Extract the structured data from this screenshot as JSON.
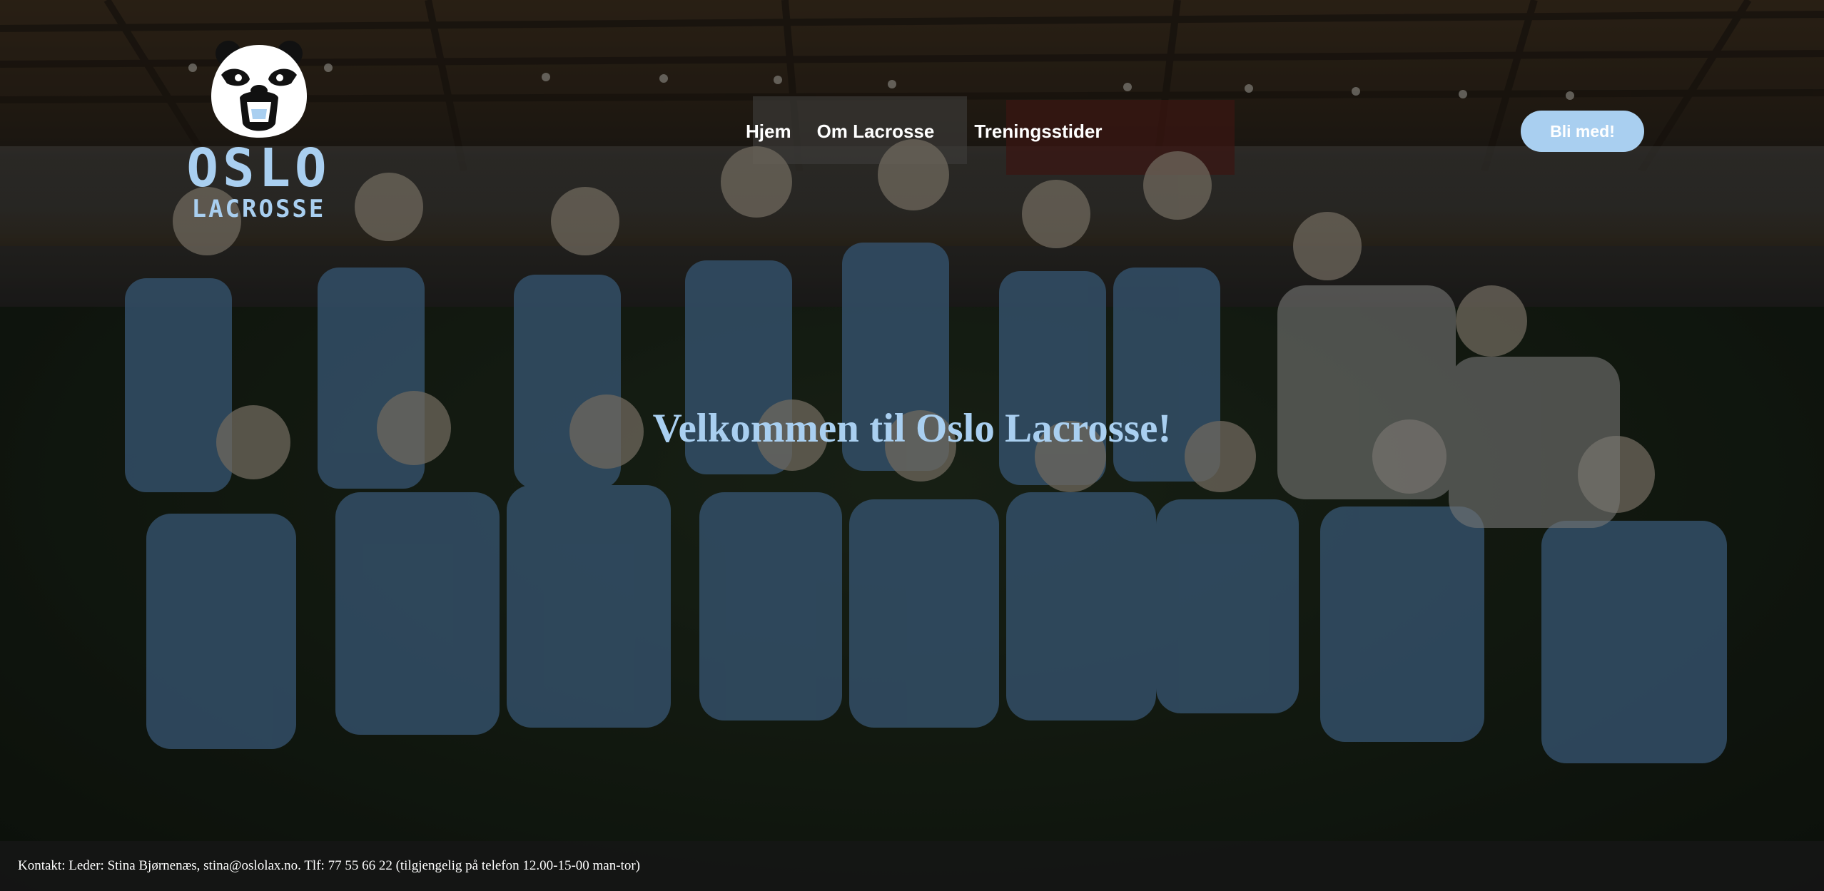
{
  "brand": {
    "line1": "OSLO",
    "line2": "LACROSSE",
    "logo_icon": "panda-mascot-icon",
    "color": "#a9cff0"
  },
  "nav": {
    "items": [
      {
        "label": "Hjem"
      },
      {
        "label": "Om Lacrosse"
      },
      {
        "label": "Treningsstider"
      }
    ]
  },
  "cta": {
    "label": "Bli med!",
    "background": "#a9cff0"
  },
  "hero": {
    "title": "Velkommen til Oslo Lacrosse!",
    "title_color": "#a9cff0",
    "background_description": "team-photo-background"
  },
  "footer": {
    "contact": "Kontakt: Leder: Stina Bjørnenæs, stina@oslolax.no. Tlf: 77 55 66 22 (tilgjengelig på telefon 12.00-15-00 man-tor)"
  }
}
